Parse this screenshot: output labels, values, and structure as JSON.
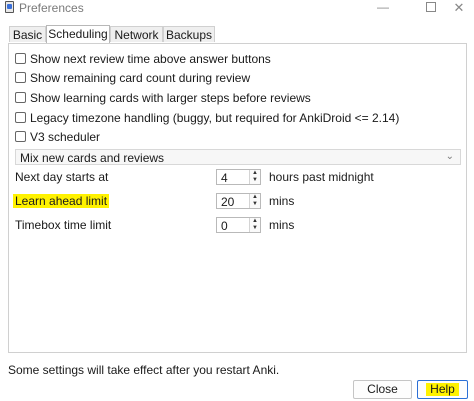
{
  "window": {
    "title": "Preferences",
    "min_glyph": "—",
    "close_glyph": "✕"
  },
  "tabs": [
    {
      "label": "Basic",
      "active": false
    },
    {
      "label": "Scheduling",
      "active": true
    },
    {
      "label": "Network",
      "active": false
    },
    {
      "label": "Backups",
      "active": false
    }
  ],
  "checkboxes": [
    {
      "label": "Show next review time above answer buttons",
      "checked": false
    },
    {
      "label": "Show remaining card count during review",
      "checked": false
    },
    {
      "label": "Show learning cards with larger steps before reviews",
      "checked": false
    },
    {
      "label": "Legacy timezone handling (buggy, but required for AnkiDroid <= 2.14)",
      "checked": false
    },
    {
      "label": "V3 scheduler",
      "checked": false
    }
  ],
  "new_review_order": {
    "value": "Mix new cards and reviews",
    "chevron": "⌄"
  },
  "fields": [
    {
      "label": "Next day starts at",
      "value": "4",
      "suffix": "hours past midnight",
      "highlighted": false
    },
    {
      "label": "Learn ahead limit",
      "value": "20",
      "suffix": "mins",
      "highlighted": true
    },
    {
      "label": "Timebox time limit",
      "value": "0",
      "suffix": "mins",
      "highlighted": false
    }
  ],
  "spin_glyphs": {
    "up": "▲",
    "down": "▼"
  },
  "footer": {
    "note": "Some settings will take effect after you restart Anki.",
    "close_label": "Close",
    "help_label": "Help"
  },
  "colors": {
    "highlight": "#fff200",
    "default_button_border": "#2b6fd6"
  }
}
